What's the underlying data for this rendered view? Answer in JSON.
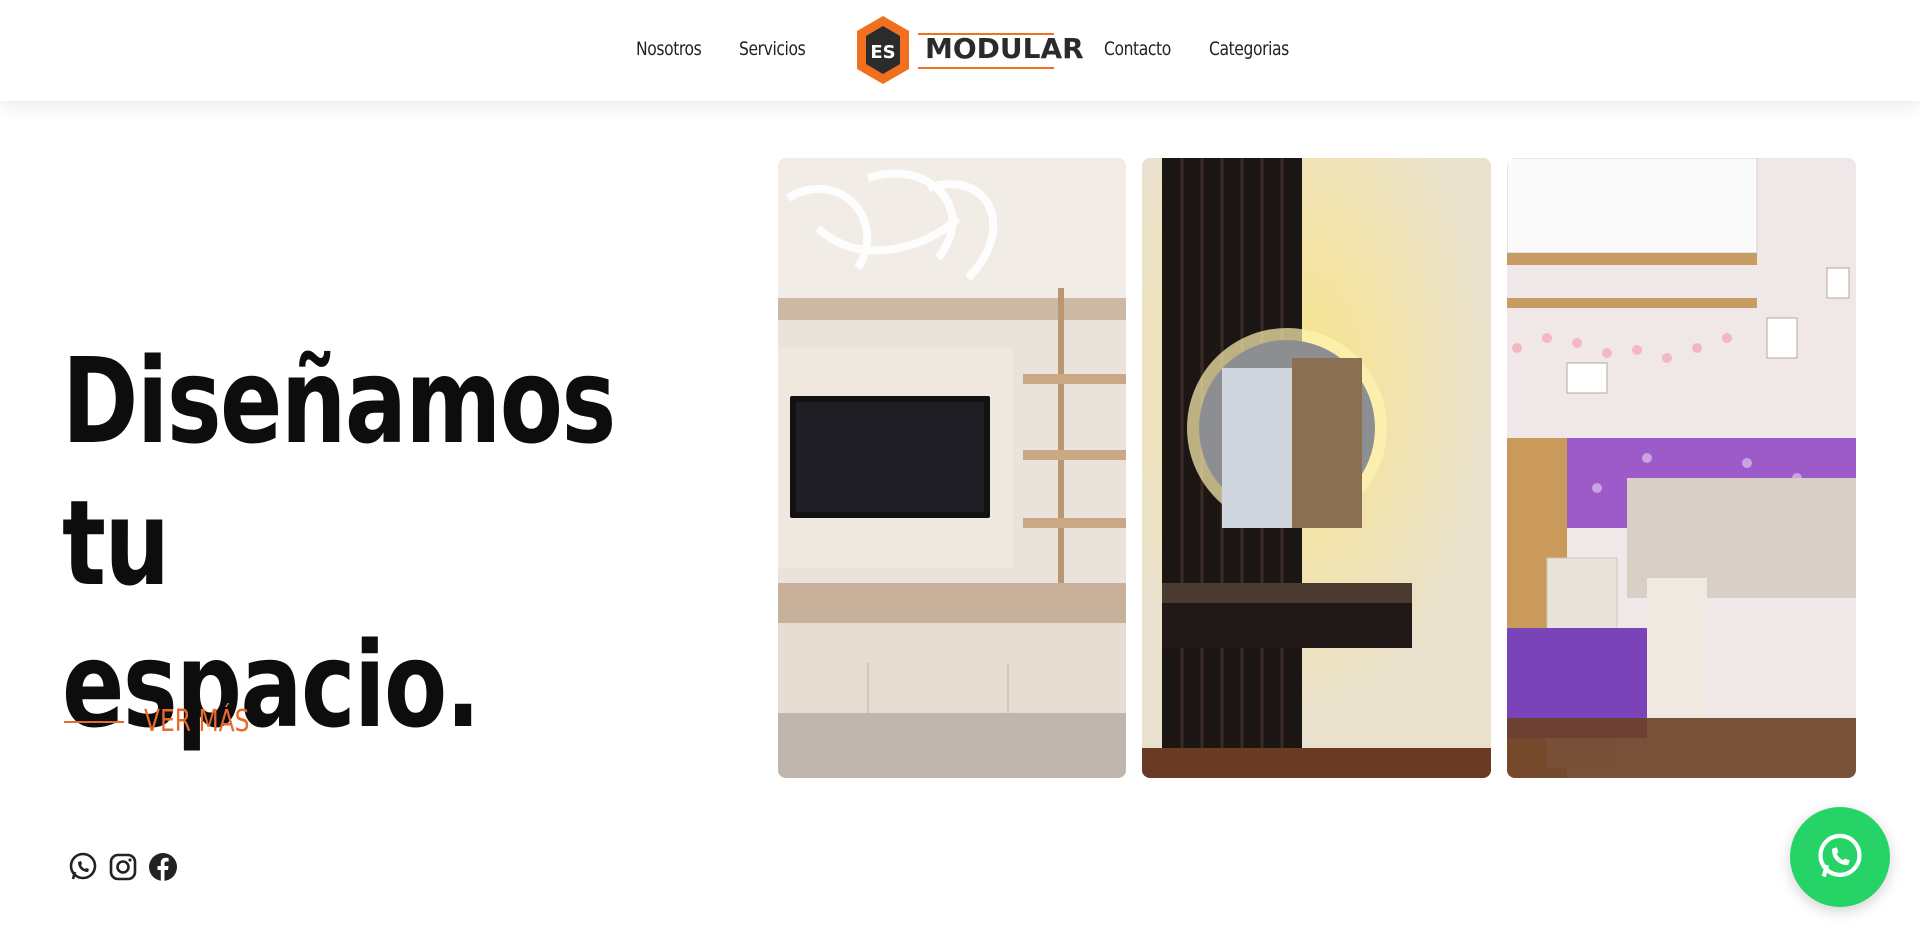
{
  "nav": {
    "left": [
      {
        "label": "Nosotros"
      },
      {
        "label": "Servicios"
      }
    ],
    "right": [
      {
        "label": "Contacto"
      },
      {
        "label": "Categorias"
      }
    ],
    "logo": {
      "badge": "ES",
      "text": "MODULAR"
    }
  },
  "hero": {
    "headline_line1": "Diseñamos tu",
    "headline_line2": "espacio.",
    "cta_label": "VER MÁS"
  },
  "gallery": [
    {
      "icon": "living-room-tv-photo"
    },
    {
      "icon": "vanity-mirror-photo"
    },
    {
      "icon": "kids-bedroom-photo"
    }
  ],
  "social": [
    {
      "icon": "whatsapp-icon"
    },
    {
      "icon": "instagram-icon"
    },
    {
      "icon": "facebook-icon"
    }
  ],
  "colors": {
    "accent": "#e8692a",
    "whatsapp": "#25d366",
    "text": "#0d0d0d"
  }
}
